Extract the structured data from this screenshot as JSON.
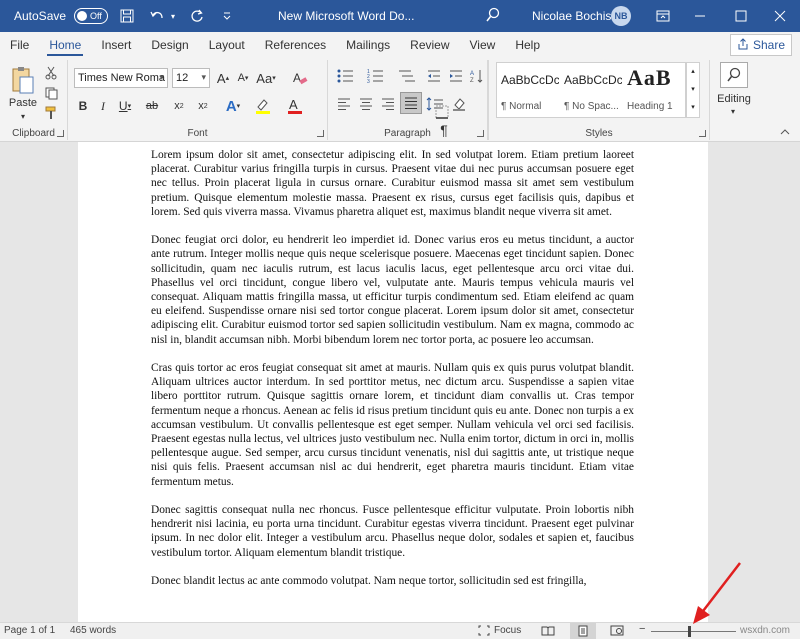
{
  "titlebar": {
    "autosave_label": "AutoSave",
    "autosave_state": "Off",
    "doc_title": "New Microsoft Word Do...",
    "user_name": "Nicolae Bochis",
    "user_initials": "NB"
  },
  "tabs": [
    "File",
    "Home",
    "Insert",
    "Design",
    "Layout",
    "References",
    "Mailings",
    "Review",
    "View",
    "Help"
  ],
  "share_label": "Share",
  "ribbon": {
    "clipboard": {
      "paste_label": "Paste",
      "group_label": "Clipboard"
    },
    "font": {
      "font_name": "Times New Roma",
      "font_size": "12",
      "group_label": "Font"
    },
    "paragraph": {
      "group_label": "Paragraph"
    },
    "styles": {
      "group_label": "Styles",
      "items": [
        {
          "sample": "AaBbCcDc",
          "name": "¶ Normal"
        },
        {
          "sample": "AaBbCcDc",
          "name": "¶ No Spac..."
        },
        {
          "sample": "AaB",
          "name": "Heading 1"
        }
      ]
    },
    "editing": {
      "label": "Editing"
    }
  },
  "document": {
    "paragraphs": [
      "Lorem ipsum dolor sit amet, consectetur adipiscing elit. In sed volutpat lorem. Etiam pretium laoreet placerat. Curabitur varius fringilla turpis in cursus. Praesent vitae dui nec purus accumsan posuere eget nec tellus. Proin placerat ligula in cursus ornare. Curabitur euismod massa sit amet sem vestibulum pretium. Quisque elementum molestie massa. Praesent ex risus, cursus eget facilisis quis, dapibus et lorem. Sed quis viverra massa. Vivamus pharetra aliquet est, maximus blandit neque viverra sit amet.",
      "Donec feugiat orci dolor, eu hendrerit leo imperdiet id. Donec varius eros eu metus tincidunt, a auctor ante rutrum. Integer mollis neque quis neque scelerisque posuere. Maecenas eget tincidunt sapien. Donec sollicitudin, quam nec iaculis rutrum, est lacus iaculis lacus, eget pellentesque arcu orci vitae dui. Phasellus vel orci tincidunt, congue libero vel, vulputate ante. Mauris tempus vehicula mauris vel consequat. Aliquam mattis fringilla massa, ut efficitur turpis condimentum sed. Etiam eleifend ac quam eu eleifend. Suspendisse ornare nisi sed tortor congue placerat. Lorem ipsum dolor sit amet, consectetur adipiscing elit. Curabitur euismod tortor sed sapien sollicitudin vestibulum. Nam ex magna, commodo ac nisl in, blandit accumsan nibh. Morbi bibendum lorem nec tortor porta, ac posuere leo accumsan.",
      "Cras quis tortor ac eros feugiat consequat sit amet at mauris. Nullam quis ex quis purus volutpat blandit. Aliquam ultrices auctor interdum. In sed porttitor metus, nec dictum arcu. Suspendisse a sapien vitae libero porttitor rutrum. Quisque sagittis ornare lorem, et tincidunt diam convallis ut. Cras tempor fermentum neque a rhoncus. Aenean ac felis id risus pretium tincidunt quis eu ante. Donec non turpis a ex accumsan vestibulum. Ut convallis pellentesque est eget semper. Nullam vehicula vel orci sed facilisis. Praesent egestas nulla lectus, vel ultrices justo vestibulum nec. Nulla enim tortor, dictum in orci in, mollis pellentesque augue. Sed semper, arcu cursus tincidunt venenatis, nisl dui sagittis ante, ut tristique neque nisi quis felis. Praesent accumsan nisl ac dui hendrerit, eget pharetra mauris tincidunt. Etiam vitae fermentum metus.",
      "Donec sagittis consequat nulla nec rhoncus. Fusce pellentesque efficitur vulputate. Proin lobortis nibh hendrerit nisi lacinia, eu porta urna tincidunt. Curabitur egestas viverra tincidunt. Praesent eget pulvinar ipsum. In nec dolor elit. Integer a vestibulum arcu. Phasellus neque dolor, sodales et sapien et, faucibus vestibulum tortor. Aliquam elementum blandit tristique.",
      "Donec blandit lectus ac ante commodo volutpat. Nam neque tortor, sollicitudin sed est fringilla,"
    ]
  },
  "statusbar": {
    "page": "Page 1 of 1",
    "words": "465 words",
    "focus": "Focus",
    "zoom_minus": "−",
    "zoom_level": 0.45,
    "watermark": "wsxdn.com"
  },
  "colors": {
    "accent": "#2b579a",
    "arrow": "#e02020"
  }
}
